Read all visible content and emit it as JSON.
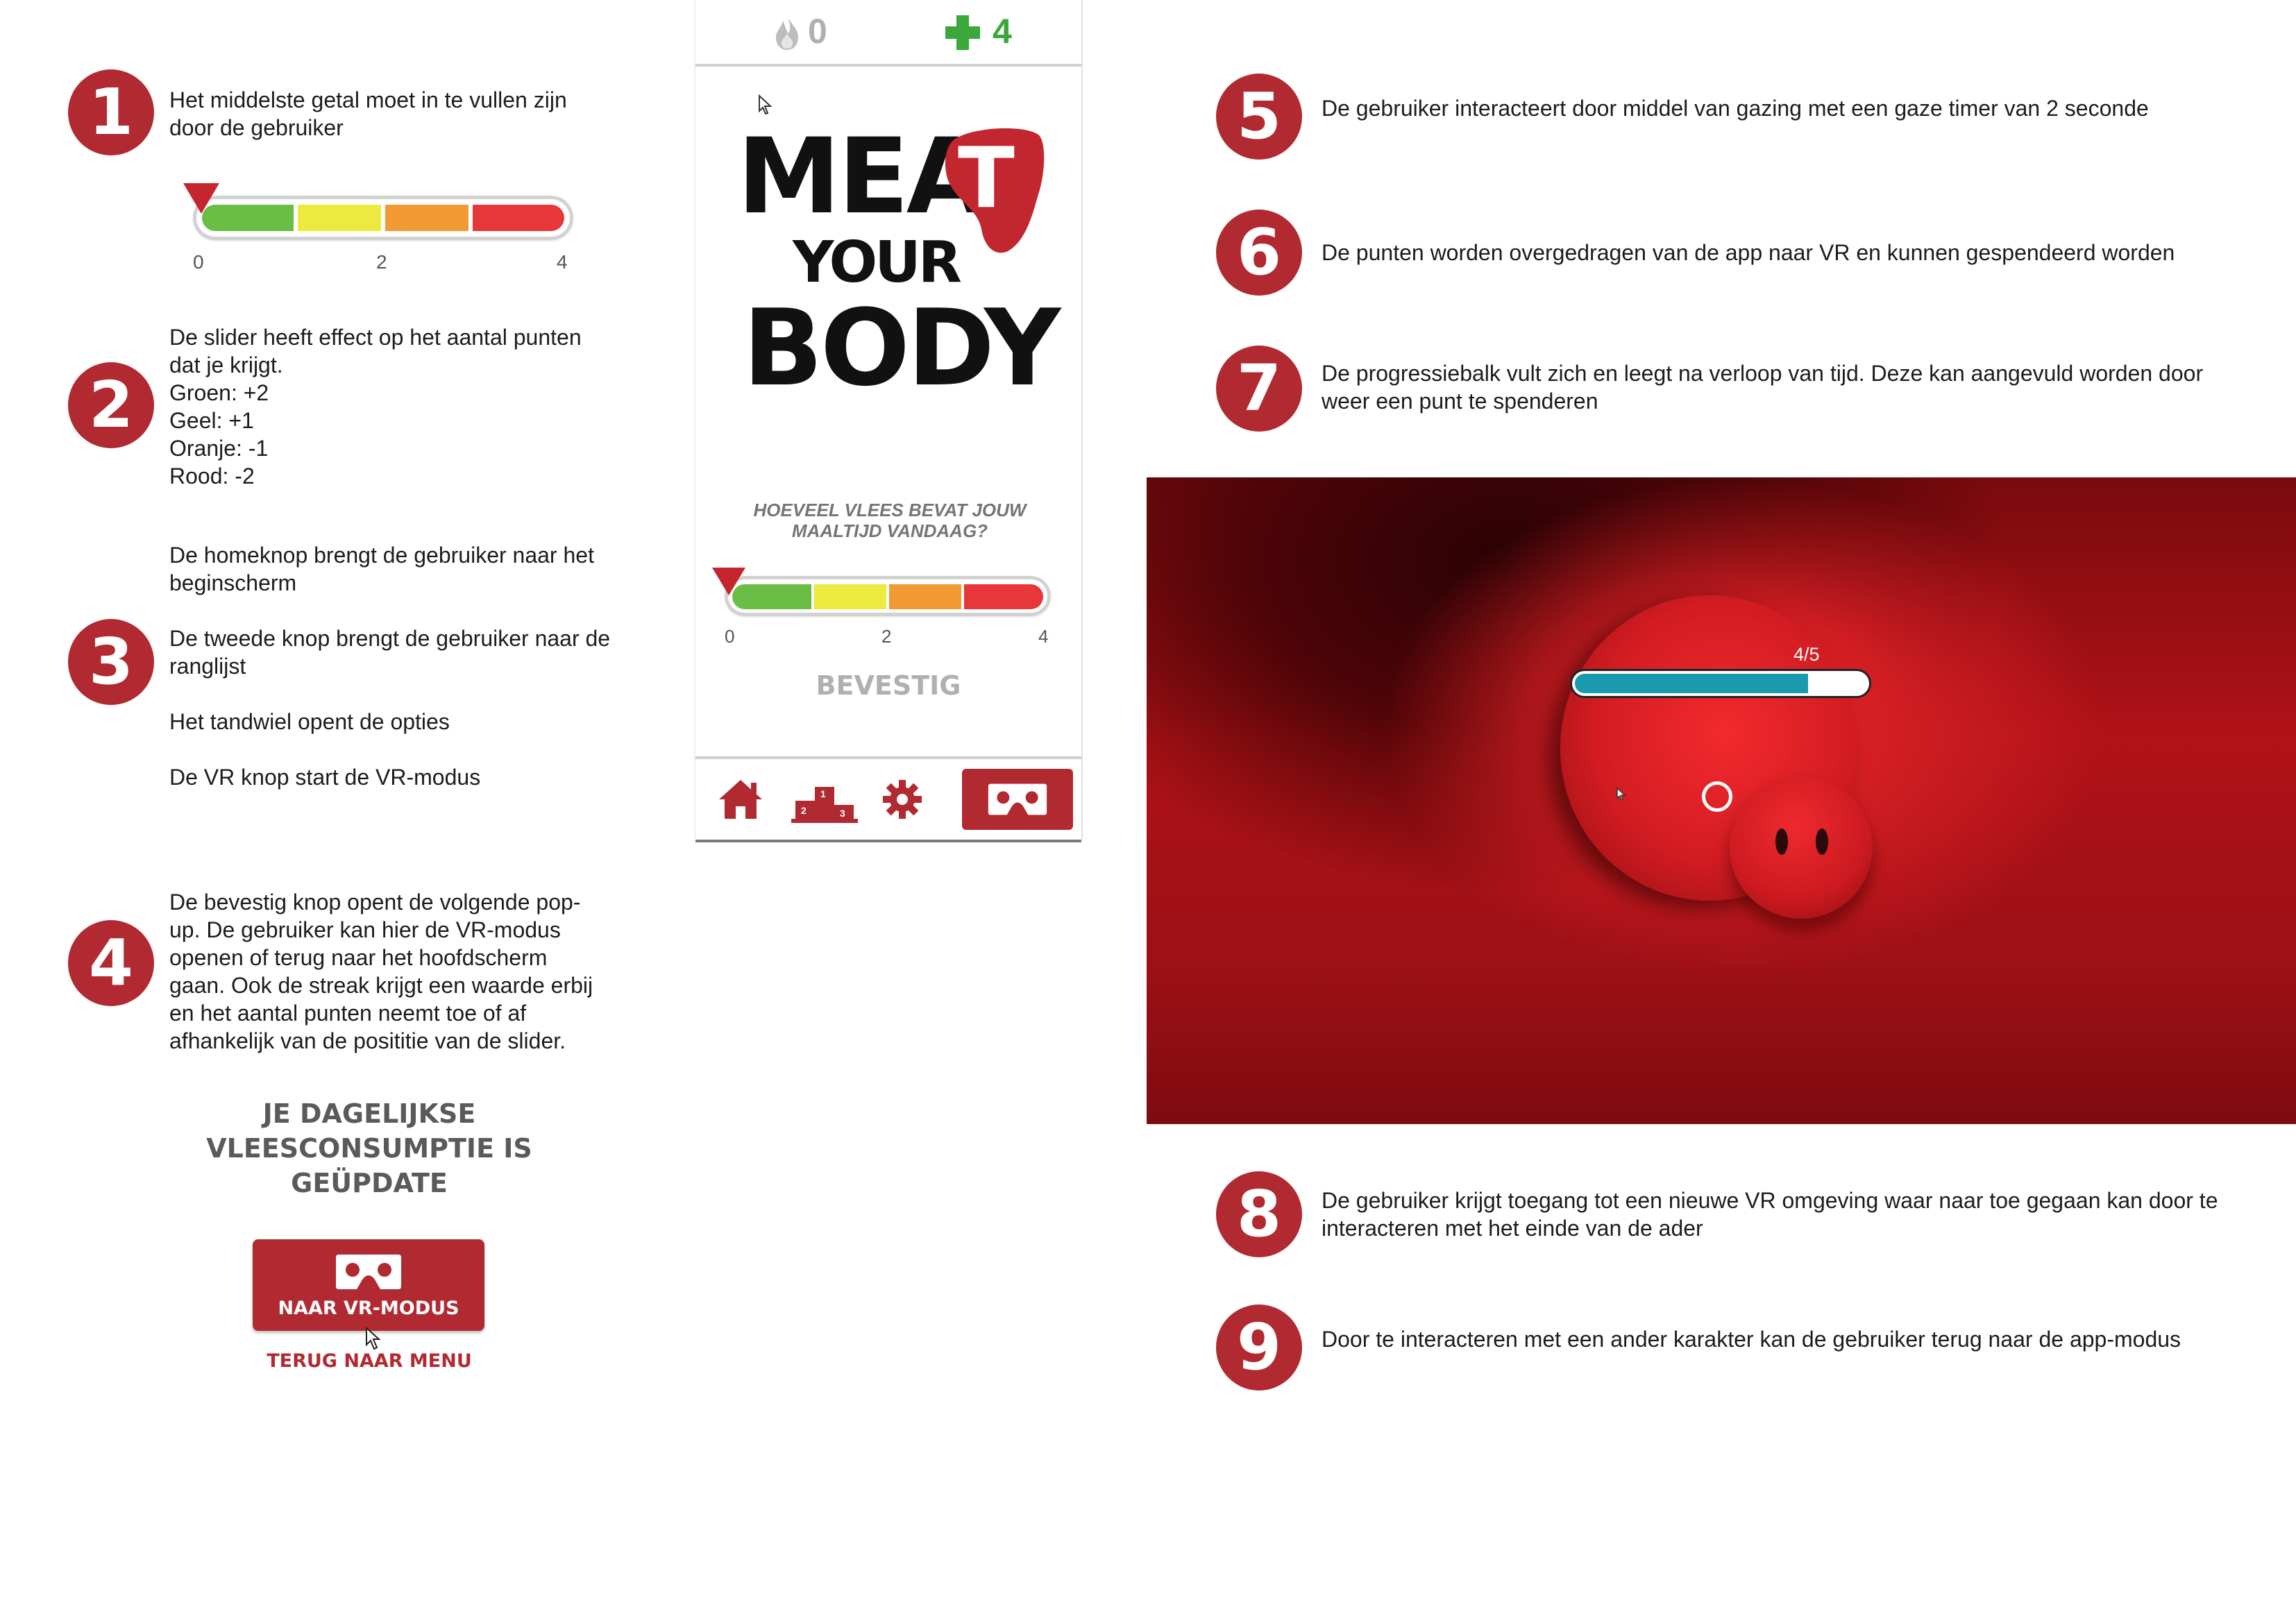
{
  "notes": {
    "n1": {
      "number": "1",
      "text": "Het middelste getal moet in te vullen zijn door de gebruiker"
    },
    "n2": {
      "number": "2",
      "lines": [
        "De slider heeft effect op het aantal punten dat je krijgt.",
        "Groen: +2",
        "Geel: +1",
        "Oranje: -1",
        "Rood: -2"
      ]
    },
    "n3": {
      "number": "3",
      "lines": [
        "De homeknop brengt de gebruiker naar het beginscherm",
        "De tweede knop brengt de gebruiker naar de ranglijst",
        "Het tandwiel opent de opties",
        "De VR knop start de VR-modus"
      ]
    },
    "n4": {
      "number": "4",
      "text": "De bevestig knop opent de volgende pop-up. De gebruiker kan hier de VR-modus openen of terug naar het hoofdscherm gaan. Ook de streak krijgt een waarde erbij en het aantal punten neemt toe of af afhankelijk van de posititie van de slider."
    },
    "n5": {
      "number": "5",
      "text": "De gebruiker interacteert door middel van gazing met een gaze timer van 2 seconde"
    },
    "n6": {
      "number": "6",
      "text": "De punten worden overgedragen van de app naar VR en kunnen gespendeerd worden"
    },
    "n7": {
      "number": "7",
      "text": "De progressiebalk vult zich en leegt na verloop van tijd. Deze kan aangevuld worden door weer een punt te spenderen"
    },
    "n8": {
      "number": "8",
      "text": "De gebruiker krijgt toegang tot een nieuwe VR omgeving waar naar toe gegaan kan door te interacteren met het einde van de ader"
    },
    "n9": {
      "number": "9",
      "text": "Door te interacteren met een ander karakter kan de gebruiker terug naar de app-modus"
    }
  },
  "slider_ticks": [
    "0",
    "2",
    "4"
  ],
  "slider_value": 0,
  "phone": {
    "streak_count": "0",
    "points_count": "4",
    "logo": {
      "meat": "MEA",
      "t": "T",
      "your": "YOUR",
      "body": "BODY"
    },
    "question": "HOEVEEL VLEES BEVAT JOUW MAALTIJD VANDAAG?",
    "confirm_label": "BEVESTIG",
    "podium_labels": [
      "1",
      "2",
      "3"
    ],
    "nav_icons": [
      "home-icon",
      "leaderboard-icon",
      "gear-icon",
      "vr-headset-icon"
    ]
  },
  "popup": {
    "title": "JE DAGELIJKSE VLEESCONSUMPTIE IS GEÜPDATE",
    "vr_button_label": "NAAR VR-MODUS",
    "back_link_label": "TERUG NAAR MENU"
  },
  "vr_scene": {
    "progress_label": "4/5",
    "progress_fraction": 0.8
  },
  "colors": {
    "accent": "#b12a31",
    "green": "#6abd45",
    "yellow": "#ecea3e",
    "orange": "#f29a33",
    "red": "#e8373a",
    "progress_fill": "#1a9aad"
  }
}
